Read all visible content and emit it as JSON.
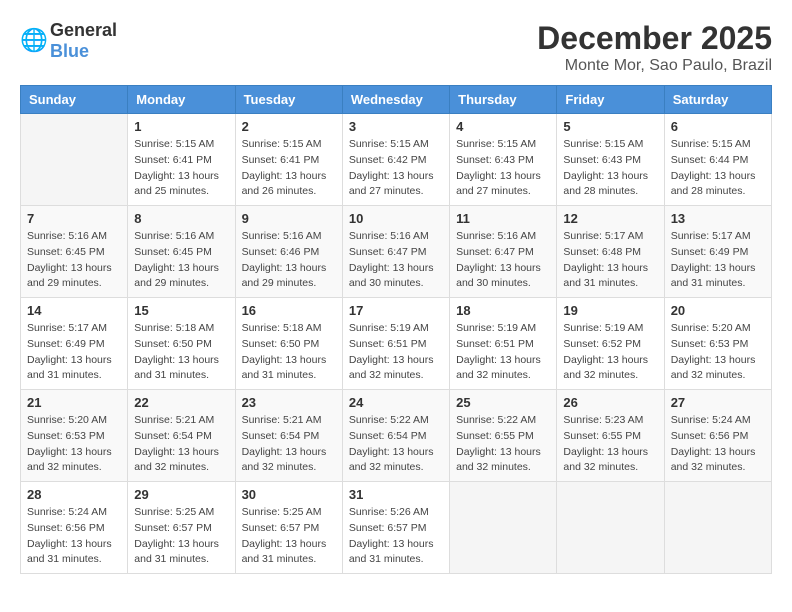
{
  "logo": {
    "general": "General",
    "blue": "Blue"
  },
  "header": {
    "month": "December 2025",
    "location": "Monte Mor, Sao Paulo, Brazil"
  },
  "weekdays": [
    "Sunday",
    "Monday",
    "Tuesday",
    "Wednesday",
    "Thursday",
    "Friday",
    "Saturday"
  ],
  "weeks": [
    [
      {
        "day": "",
        "sunrise": "",
        "sunset": "",
        "daylight": ""
      },
      {
        "day": "1",
        "sunrise": "Sunrise: 5:15 AM",
        "sunset": "Sunset: 6:41 PM",
        "daylight": "Daylight: 13 hours and 25 minutes."
      },
      {
        "day": "2",
        "sunrise": "Sunrise: 5:15 AM",
        "sunset": "Sunset: 6:41 PM",
        "daylight": "Daylight: 13 hours and 26 minutes."
      },
      {
        "day": "3",
        "sunrise": "Sunrise: 5:15 AM",
        "sunset": "Sunset: 6:42 PM",
        "daylight": "Daylight: 13 hours and 27 minutes."
      },
      {
        "day": "4",
        "sunrise": "Sunrise: 5:15 AM",
        "sunset": "Sunset: 6:43 PM",
        "daylight": "Daylight: 13 hours and 27 minutes."
      },
      {
        "day": "5",
        "sunrise": "Sunrise: 5:15 AM",
        "sunset": "Sunset: 6:43 PM",
        "daylight": "Daylight: 13 hours and 28 minutes."
      },
      {
        "day": "6",
        "sunrise": "Sunrise: 5:15 AM",
        "sunset": "Sunset: 6:44 PM",
        "daylight": "Daylight: 13 hours and 28 minutes."
      }
    ],
    [
      {
        "day": "7",
        "sunrise": "Sunrise: 5:16 AM",
        "sunset": "Sunset: 6:45 PM",
        "daylight": "Daylight: 13 hours and 29 minutes."
      },
      {
        "day": "8",
        "sunrise": "Sunrise: 5:16 AM",
        "sunset": "Sunset: 6:45 PM",
        "daylight": "Daylight: 13 hours and 29 minutes."
      },
      {
        "day": "9",
        "sunrise": "Sunrise: 5:16 AM",
        "sunset": "Sunset: 6:46 PM",
        "daylight": "Daylight: 13 hours and 29 minutes."
      },
      {
        "day": "10",
        "sunrise": "Sunrise: 5:16 AM",
        "sunset": "Sunset: 6:47 PM",
        "daylight": "Daylight: 13 hours and 30 minutes."
      },
      {
        "day": "11",
        "sunrise": "Sunrise: 5:16 AM",
        "sunset": "Sunset: 6:47 PM",
        "daylight": "Daylight: 13 hours and 30 minutes."
      },
      {
        "day": "12",
        "sunrise": "Sunrise: 5:17 AM",
        "sunset": "Sunset: 6:48 PM",
        "daylight": "Daylight: 13 hours and 31 minutes."
      },
      {
        "day": "13",
        "sunrise": "Sunrise: 5:17 AM",
        "sunset": "Sunset: 6:49 PM",
        "daylight": "Daylight: 13 hours and 31 minutes."
      }
    ],
    [
      {
        "day": "14",
        "sunrise": "Sunrise: 5:17 AM",
        "sunset": "Sunset: 6:49 PM",
        "daylight": "Daylight: 13 hours and 31 minutes."
      },
      {
        "day": "15",
        "sunrise": "Sunrise: 5:18 AM",
        "sunset": "Sunset: 6:50 PM",
        "daylight": "Daylight: 13 hours and 31 minutes."
      },
      {
        "day": "16",
        "sunrise": "Sunrise: 5:18 AM",
        "sunset": "Sunset: 6:50 PM",
        "daylight": "Daylight: 13 hours and 31 minutes."
      },
      {
        "day": "17",
        "sunrise": "Sunrise: 5:19 AM",
        "sunset": "Sunset: 6:51 PM",
        "daylight": "Daylight: 13 hours and 32 minutes."
      },
      {
        "day": "18",
        "sunrise": "Sunrise: 5:19 AM",
        "sunset": "Sunset: 6:51 PM",
        "daylight": "Daylight: 13 hours and 32 minutes."
      },
      {
        "day": "19",
        "sunrise": "Sunrise: 5:19 AM",
        "sunset": "Sunset: 6:52 PM",
        "daylight": "Daylight: 13 hours and 32 minutes."
      },
      {
        "day": "20",
        "sunrise": "Sunrise: 5:20 AM",
        "sunset": "Sunset: 6:53 PM",
        "daylight": "Daylight: 13 hours and 32 minutes."
      }
    ],
    [
      {
        "day": "21",
        "sunrise": "Sunrise: 5:20 AM",
        "sunset": "Sunset: 6:53 PM",
        "daylight": "Daylight: 13 hours and 32 minutes."
      },
      {
        "day": "22",
        "sunrise": "Sunrise: 5:21 AM",
        "sunset": "Sunset: 6:54 PM",
        "daylight": "Daylight: 13 hours and 32 minutes."
      },
      {
        "day": "23",
        "sunrise": "Sunrise: 5:21 AM",
        "sunset": "Sunset: 6:54 PM",
        "daylight": "Daylight: 13 hours and 32 minutes."
      },
      {
        "day": "24",
        "sunrise": "Sunrise: 5:22 AM",
        "sunset": "Sunset: 6:54 PM",
        "daylight": "Daylight: 13 hours and 32 minutes."
      },
      {
        "day": "25",
        "sunrise": "Sunrise: 5:22 AM",
        "sunset": "Sunset: 6:55 PM",
        "daylight": "Daylight: 13 hours and 32 minutes."
      },
      {
        "day": "26",
        "sunrise": "Sunrise: 5:23 AM",
        "sunset": "Sunset: 6:55 PM",
        "daylight": "Daylight: 13 hours and 32 minutes."
      },
      {
        "day": "27",
        "sunrise": "Sunrise: 5:24 AM",
        "sunset": "Sunset: 6:56 PM",
        "daylight": "Daylight: 13 hours and 32 minutes."
      }
    ],
    [
      {
        "day": "28",
        "sunrise": "Sunrise: 5:24 AM",
        "sunset": "Sunset: 6:56 PM",
        "daylight": "Daylight: 13 hours and 31 minutes."
      },
      {
        "day": "29",
        "sunrise": "Sunrise: 5:25 AM",
        "sunset": "Sunset: 6:57 PM",
        "daylight": "Daylight: 13 hours and 31 minutes."
      },
      {
        "day": "30",
        "sunrise": "Sunrise: 5:25 AM",
        "sunset": "Sunset: 6:57 PM",
        "daylight": "Daylight: 13 hours and 31 minutes."
      },
      {
        "day": "31",
        "sunrise": "Sunrise: 5:26 AM",
        "sunset": "Sunset: 6:57 PM",
        "daylight": "Daylight: 13 hours and 31 minutes."
      },
      {
        "day": "",
        "sunrise": "",
        "sunset": "",
        "daylight": ""
      },
      {
        "day": "",
        "sunrise": "",
        "sunset": "",
        "daylight": ""
      },
      {
        "day": "",
        "sunrise": "",
        "sunset": "",
        "daylight": ""
      }
    ]
  ]
}
